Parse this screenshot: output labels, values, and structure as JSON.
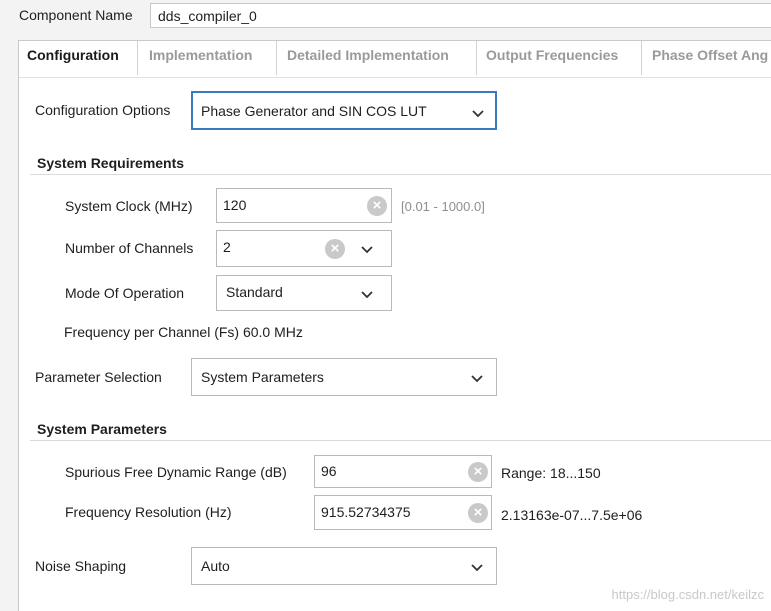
{
  "component": {
    "label": "Component Name",
    "value": "dds_compiler_0"
  },
  "tabs": [
    {
      "label": "Configuration",
      "active": true
    },
    {
      "label": "Implementation",
      "active": false
    },
    {
      "label": "Detailed Implementation",
      "active": false
    },
    {
      "label": "Output Frequencies",
      "active": false
    },
    {
      "label": "Phase Offset Ang",
      "active": false
    }
  ],
  "config_options": {
    "label": "Configuration Options",
    "value": "Phase Generator and SIN COS LUT"
  },
  "system_requirements": {
    "title": "System Requirements",
    "clock": {
      "label": "System Clock (MHz)",
      "value": "120",
      "range": "[0.01 - 1000.0]"
    },
    "channels": {
      "label": "Number of Channels",
      "value": "2"
    },
    "mode": {
      "label": "Mode Of Operation",
      "value": "Standard"
    },
    "fs_text": "Frequency per Channel (Fs) 60.0 MHz"
  },
  "parameter_selection": {
    "label": "Parameter Selection",
    "value": "System Parameters"
  },
  "system_parameters": {
    "title": "System Parameters",
    "sfdr": {
      "label": "Spurious Free Dynamic Range (dB)",
      "value": "96",
      "range": "Range: 18...150"
    },
    "freq_res": {
      "label": "Frequency Resolution (Hz)",
      "value": "915.52734375",
      "range": "2.13163e-07...7.5e+06"
    }
  },
  "noise_shaping": {
    "label": "Noise Shaping",
    "value": "Auto"
  },
  "watermark": "https://blog.csdn.net/keilzc",
  "icons": {
    "clear": "clear-x-icon",
    "dropdown": "chevron-down-icon"
  },
  "colors": {
    "focus_border": "#3b78c2",
    "panel_bg": "#ffffff",
    "window_bg": "#f3f3f3"
  }
}
